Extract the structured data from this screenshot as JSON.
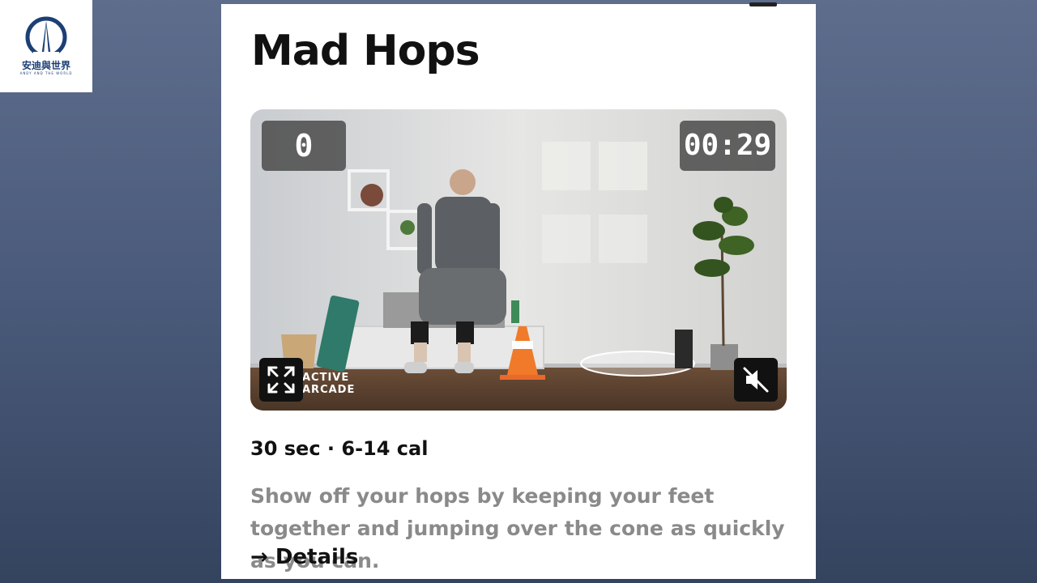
{
  "logo": {
    "name_cn": "安迪與世界",
    "name_en": "ANDY AND THE WORLD",
    "color": "#1c3f75"
  },
  "card": {
    "title": "Mad Hops",
    "video": {
      "score": "0",
      "timer": "00:29",
      "brand_line1": "ACTIVE",
      "brand_line2": "ARCADE",
      "fullscreen_icon": "expand-arrows-icon",
      "mute_icon": "speaker-muted-icon",
      "muted": true
    },
    "meta": "30 sec · 6-14 cal",
    "description": "Show off your hops by keeping your feet together and jumping over the cone as quickly as you can.",
    "details_link": "→ Details"
  }
}
